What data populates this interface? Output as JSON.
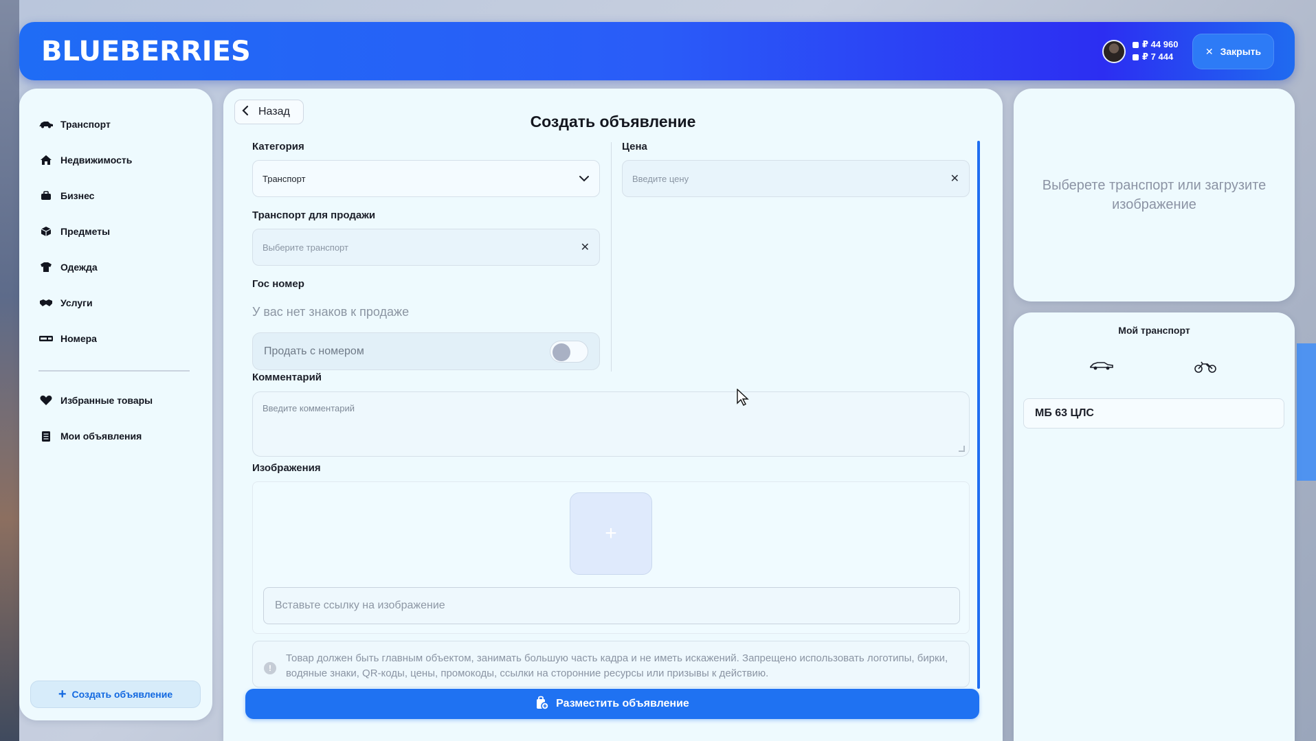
{
  "header": {
    "brand": "BLUEBERRIES",
    "balance_primary": "₽ 44 960",
    "balance_secondary": "₽ 7 444",
    "close_label": "Закрыть"
  },
  "sidebar": {
    "items": [
      {
        "label": "Транспорт",
        "icon": "car-icon"
      },
      {
        "label": "Недвижимость",
        "icon": "house-icon"
      },
      {
        "label": "Бизнес",
        "icon": "briefcase-icon"
      },
      {
        "label": "Предметы",
        "icon": "box-icon"
      },
      {
        "label": "Одежда",
        "icon": "shirt-icon"
      },
      {
        "label": "Услуги",
        "icon": "handshake-icon"
      },
      {
        "label": "Номера",
        "icon": "plate-icon"
      }
    ],
    "bottom_items": [
      {
        "label": "Избранные товары",
        "icon": "heart-icon"
      },
      {
        "label": "Мои объявления",
        "icon": "list-icon"
      }
    ],
    "create_label": "Создать объявление"
  },
  "form": {
    "back_label": "Назад",
    "title": "Создать объявление",
    "category_label": "Категория",
    "category_value": "Транспорт",
    "price_label": "Цена",
    "price_placeholder": "Введите цену",
    "vehicle_label": "Транспорт для продажи",
    "vehicle_placeholder": "Выберите транспорт",
    "plate_label": "Гос номер",
    "no_plates_text": "У вас нет знаков к продаже",
    "sell_with_plate_label": "Продать с номером",
    "sell_with_plate_on": false,
    "comment_label": "Комментарий",
    "comment_placeholder": "Введите комментарий",
    "images_label": "Изображения",
    "add_image_symbol": "+",
    "image_url_placeholder": "Вставьте ссылку на изображение",
    "notice_text": "Товар должен быть главным объектом, занимать большую часть кадра и не иметь искажений. Запрещено использовать логотипы, бирки, водяные знаки, QR-коды, цены, промокоды, ссылки на сторонние ресурсы или призывы к действию.",
    "submit_label": "Разместить объявление"
  },
  "preview": {
    "placeholder_text": "Выберете транспорт или загрузите изображение"
  },
  "my_vehicles": {
    "title": "Мой транспорт",
    "tabs": [
      "car-icon",
      "motorcycle-icon"
    ],
    "items": [
      "МБ 63 ЦЛС"
    ]
  },
  "colors": {
    "accent": "#1f72f2",
    "header_gradient_start": "#1f6cf5",
    "header_gradient_end": "#2c2ef2",
    "panel_bg": "#eefafe"
  }
}
